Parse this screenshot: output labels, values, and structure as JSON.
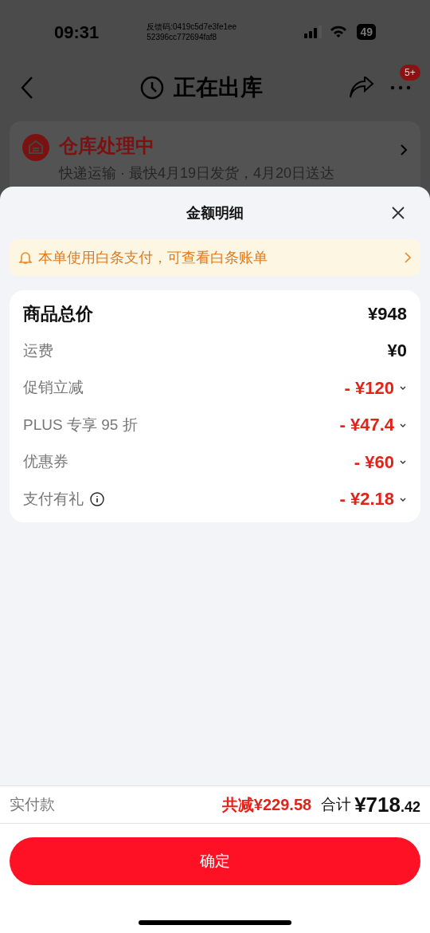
{
  "status_bar": {
    "time": "09:31",
    "feedback_code": [
      "反馈码:0419c5d7e3fe1ee",
      "52396cc772694faf8"
    ],
    "battery": "49"
  },
  "nav": {
    "title": "正在出库",
    "badge": "5+"
  },
  "order_card": {
    "title": "仓库处理中",
    "subtitle": "快递运输 · 最快4月19日发货，4月20日送达"
  },
  "sheet": {
    "title": "金额明细",
    "notice": "本单使用白条支付，可查看白条账单",
    "rows": [
      {
        "kind": "total",
        "label": "商品总价",
        "value": "¥948",
        "info": false
      },
      {
        "kind": "plain",
        "label": "运费",
        "value": "¥0",
        "info": false
      },
      {
        "kind": "discount",
        "label": "促销立减",
        "value": "- ¥120",
        "info": false
      },
      {
        "kind": "discount",
        "label": "PLUS 专享 95 折",
        "value": "- ¥47.4",
        "info": false
      },
      {
        "kind": "discount",
        "label": "优惠券",
        "value": "- ¥60",
        "info": false
      },
      {
        "kind": "discount",
        "label": "支付有礼",
        "value": "- ¥2.18",
        "info": true
      }
    ],
    "footer": {
      "label": "实付款",
      "saved": "共减¥229.58",
      "total_label": "合计",
      "total_main": "¥718",
      "total_decimal": ".42"
    },
    "confirm": "确定"
  }
}
